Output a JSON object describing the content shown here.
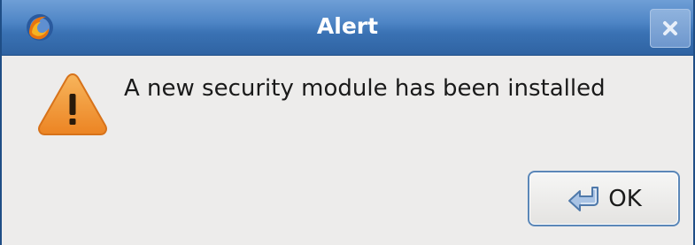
{
  "window": {
    "title": "Alert"
  },
  "icons": {
    "app": "firefox-icon",
    "close": "close-icon",
    "warning": "warning-icon",
    "enter": "enter-arrow-icon"
  },
  "dialog": {
    "message": "A new security module has been installed",
    "ok_label": "OK"
  },
  "colors": {
    "titlebar": "#3a72b4",
    "body": "#edeceb",
    "warning": "#f29b34",
    "button_border": "#5b87b8"
  }
}
